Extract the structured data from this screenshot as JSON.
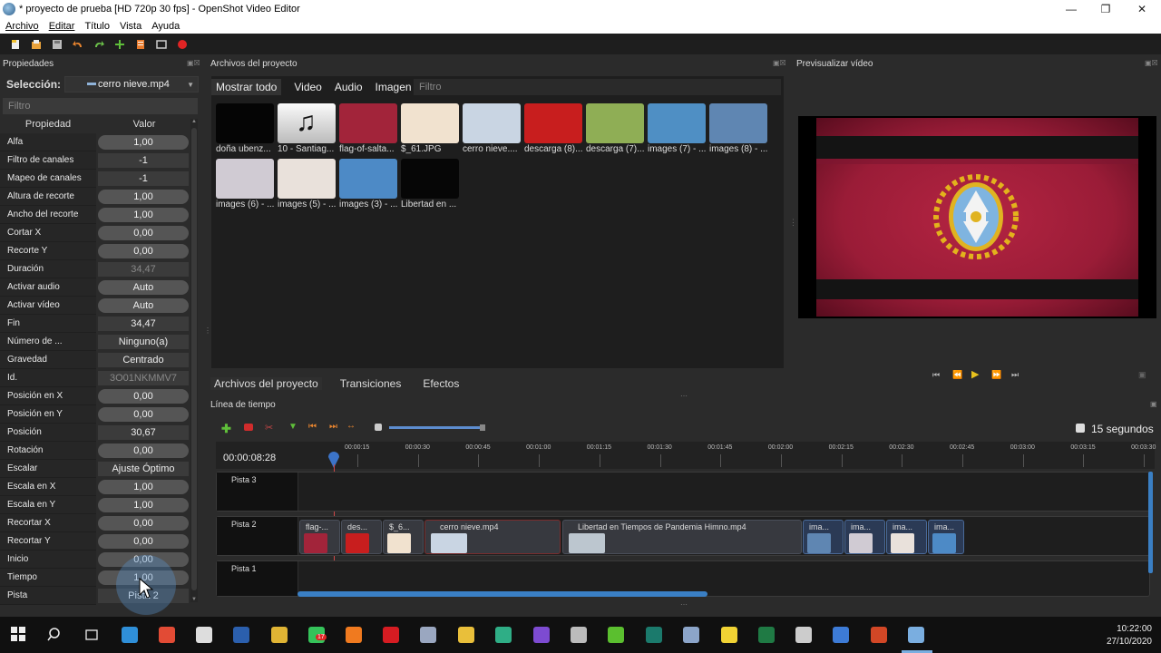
{
  "window": {
    "title": "* proyecto de prueba [HD 720p 30 fps] - OpenShot Video Editor"
  },
  "menu": [
    "Archivo",
    "Editar",
    "Título",
    "Vista",
    "Ayuda"
  ],
  "toolbar": {
    "icons": [
      "new-project-icon",
      "open-project-icon",
      "save-project-icon",
      "undo-icon",
      "redo-icon",
      "import-files-icon",
      "choose-profile-icon",
      "fullscreen-icon",
      "export-video-icon"
    ]
  },
  "properties": {
    "title": "Propiedades",
    "selection_label": "Selección:",
    "selection_value": "cerro nieve.mp4",
    "filter_placeholder": "Filtro",
    "col_property": "Propiedad",
    "col_value": "Valor",
    "rows": [
      {
        "name": "Alfa",
        "value": "1,00",
        "style": "slider"
      },
      {
        "name": "Filtro de canales",
        "value": "-1",
        "style": "flat"
      },
      {
        "name": "Mapeo de canales",
        "value": "-1",
        "style": "flat"
      },
      {
        "name": "Altura de recorte",
        "value": "1,00",
        "style": "slider"
      },
      {
        "name": "Ancho del recorte",
        "value": "1,00",
        "style": "slider"
      },
      {
        "name": "Cortar X",
        "value": "0,00",
        "style": "slider"
      },
      {
        "name": "Recorte Y",
        "value": "0,00",
        "style": "slider"
      },
      {
        "name": "Duración",
        "value": "34,47",
        "style": "dim"
      },
      {
        "name": "Activar audio",
        "value": "Auto",
        "style": "slider"
      },
      {
        "name": "Activar vídeo",
        "value": "Auto",
        "style": "slider"
      },
      {
        "name": "Fin",
        "value": "34,47",
        "style": "flat"
      },
      {
        "name": "Número de ...",
        "value": "Ninguno(a)",
        "style": "flat"
      },
      {
        "name": "Gravedad",
        "value": "Centrado",
        "style": "flat"
      },
      {
        "name": "Id.",
        "value": "3O01NKMMV7",
        "style": "dim"
      },
      {
        "name": "Posición en X",
        "value": "0,00",
        "style": "slider"
      },
      {
        "name": "Posición en Y",
        "value": "0,00",
        "style": "slider"
      },
      {
        "name": "Posición",
        "value": "30,67",
        "style": "flat"
      },
      {
        "name": "Rotación",
        "value": "0,00",
        "style": "slider"
      },
      {
        "name": "Escalar",
        "value": "Ajuste Óptimo",
        "style": "flat"
      },
      {
        "name": "Escala en X",
        "value": "1,00",
        "style": "slider"
      },
      {
        "name": "Escala en Y",
        "value": "1,00",
        "style": "slider"
      },
      {
        "name": "Recortar X",
        "value": "0,00",
        "style": "slider"
      },
      {
        "name": "Recortar Y",
        "value": "0,00",
        "style": "slider"
      },
      {
        "name": "Inicio",
        "value": "0,00",
        "style": "slider"
      },
      {
        "name": "Tiempo",
        "value": "1,00",
        "style": "slider"
      },
      {
        "name": "Pista",
        "value": "Pista 2",
        "style": "flat"
      }
    ]
  },
  "files": {
    "title": "Archivos del proyecto",
    "tabs": [
      "Mostrar todo",
      "Video",
      "Audio",
      "Imagen"
    ],
    "filter_placeholder": "Filtro",
    "items": [
      {
        "label": "doña ubenz...",
        "color": "#050505"
      },
      {
        "label": "10 - Santiag...",
        "color": "#ffffff"
      },
      {
        "label": "flag-of-salta...",
        "color": "#a2243a"
      },
      {
        "label": "$_61.JPG",
        "color": "#f1e2cf"
      },
      {
        "label": "cerro nieve....",
        "color": "#c9d5e3"
      },
      {
        "label": "descarga (8)...",
        "color": "#c81e1e"
      },
      {
        "label": "descarga (7)...",
        "color": "#8fae55"
      },
      {
        "label": "images (7) - ...",
        "color": "#4f8fc4"
      },
      {
        "label": "images (8) - ...",
        "color": "#5f86b2"
      },
      {
        "label": "images (6) - ...",
        "color": "#d0cbd3"
      },
      {
        "label": "images (5) - ...",
        "color": "#e9e1db"
      },
      {
        "label": "images (3) - ...",
        "color": "#4d8ac6"
      },
      {
        "label": "Libertad en ...",
        "color": "#060606"
      }
    ]
  },
  "bottom_tabs": [
    "Archivos del proyecto",
    "Transiciones",
    "Efectos"
  ],
  "preview": {
    "title": "Previsualizar vídeo"
  },
  "timeline": {
    "title": "Línea de tiempo",
    "zoom_label": "15 segundos",
    "current_time": "00:00:08:28",
    "ruler_ticks": [
      "00:00:15",
      "00:00:30",
      "00:00:45",
      "00:01:00",
      "00:01:15",
      "00:01:30",
      "00:01:45",
      "00:02:00",
      "00:02:15",
      "00:02:30",
      "00:02:45",
      "00:03:00",
      "00:03:15",
      "00:03:30"
    ],
    "tracks": [
      "Pista 3",
      "Pista 2",
      "Pista 1"
    ],
    "clips": [
      {
        "label": "flag-...",
        "color": "#a2243a"
      },
      {
        "label": "des...",
        "color": "#c81e1e"
      },
      {
        "label": "$_6...",
        "color": "#f1e2cf"
      },
      {
        "label": "cerro nieve.mp4",
        "color": "#c9d5e3"
      },
      {
        "label": "Libertad en Tiempos de Pandemia Himno.mp4",
        "color": "#bcc6cf"
      },
      {
        "label": "ima...",
        "color": "#5f86b2"
      },
      {
        "label": "ima...",
        "color": "#d0cbd3"
      },
      {
        "label": "ima...",
        "color": "#e9e1db"
      },
      {
        "label": "ima...",
        "color": "#4d8ac6"
      }
    ]
  },
  "taskbar": {
    "time": "10:22:00",
    "date": "27/10/2020",
    "whatsapp_badge": "17"
  }
}
